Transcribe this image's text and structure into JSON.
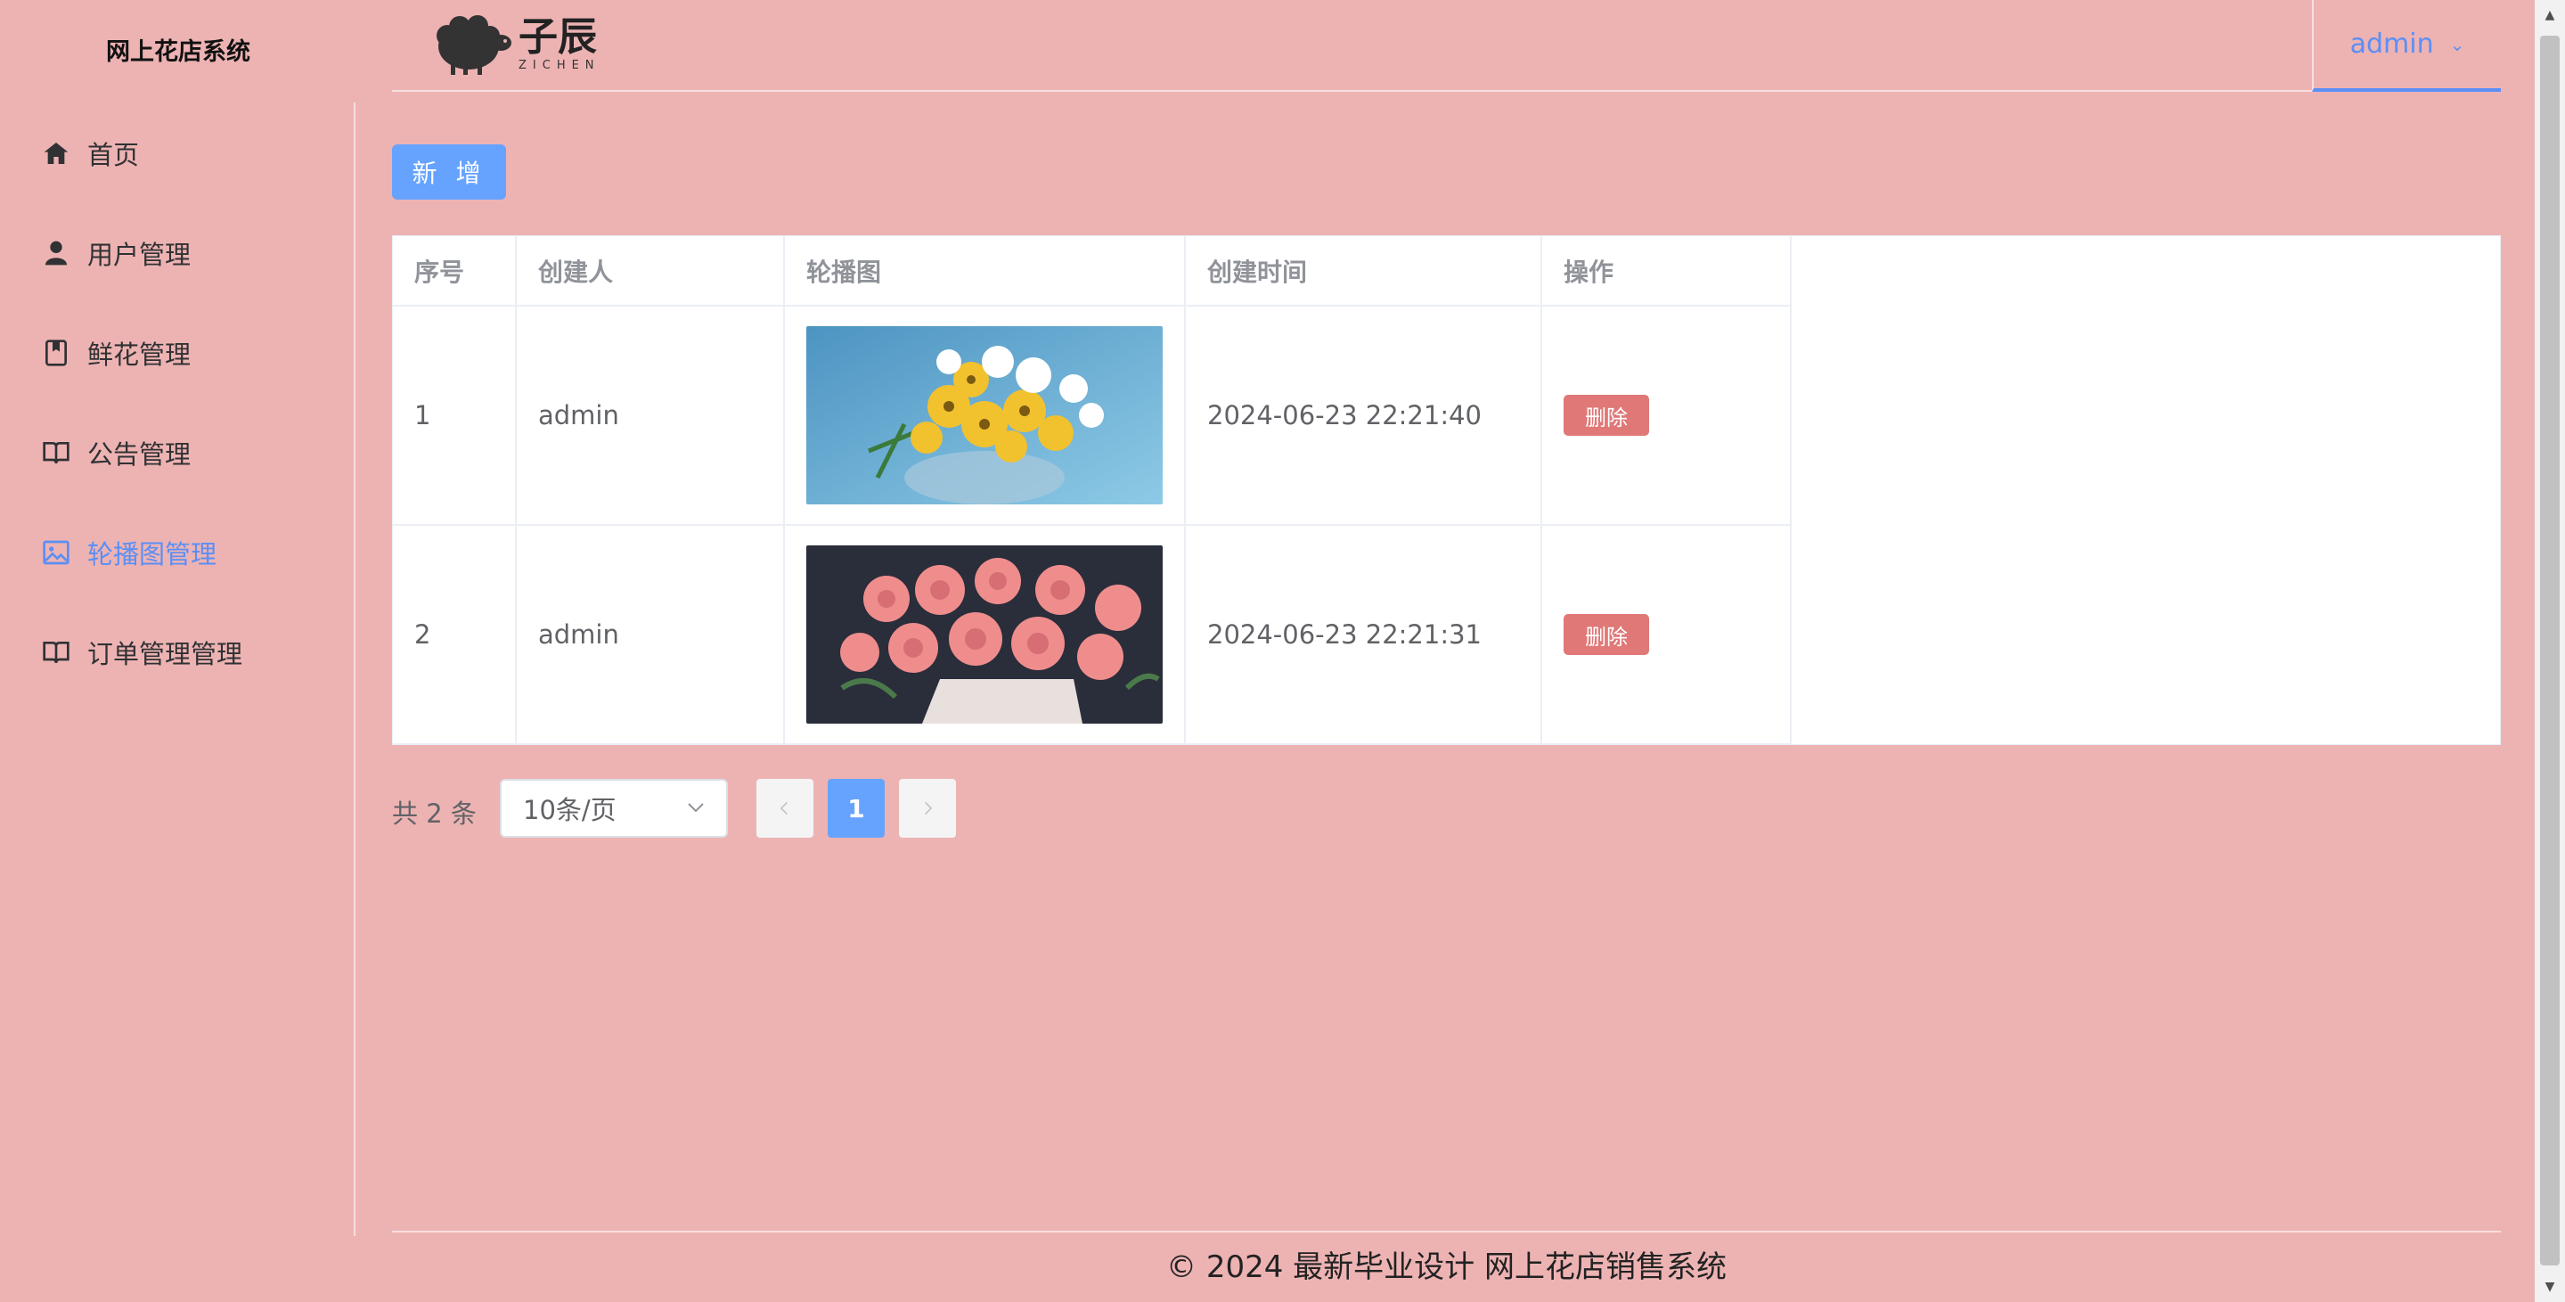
{
  "app": {
    "brand": "网上花店系统"
  },
  "logo": {
    "cn": "子辰",
    "en": "ZICHEN"
  },
  "header": {
    "user": "admin"
  },
  "sidebar": {
    "items": [
      {
        "label": "首页",
        "icon": "home-icon"
      },
      {
        "label": "用户管理",
        "icon": "user-icon"
      },
      {
        "label": "鲜花管理",
        "icon": "notebook-icon"
      },
      {
        "label": "公告管理",
        "icon": "book-icon"
      },
      {
        "label": "轮播图管理",
        "icon": "picture-icon",
        "active": true
      },
      {
        "label": "订单管理管理",
        "icon": "book-icon"
      }
    ]
  },
  "toolbar": {
    "add_label": "新 增"
  },
  "table": {
    "headers": [
      "序号",
      "创建人",
      "轮播图",
      "创建时间",
      "操作"
    ],
    "rows": [
      {
        "index": "1",
        "creator": "admin",
        "time": "2024-06-23 22:21:40",
        "action": "删除"
      },
      {
        "index": "2",
        "creator": "admin",
        "time": "2024-06-23 22:21:31",
        "action": "删除"
      }
    ]
  },
  "pagination": {
    "total": "共 2 条",
    "page_size": "10条/页",
    "current": "1"
  },
  "footer": {
    "text": "© 2024 最新毕业设计 网上花店销售系统"
  },
  "colors": {
    "background": "#edb3b3",
    "accent": "#66a3ff",
    "danger": "#e07878"
  }
}
